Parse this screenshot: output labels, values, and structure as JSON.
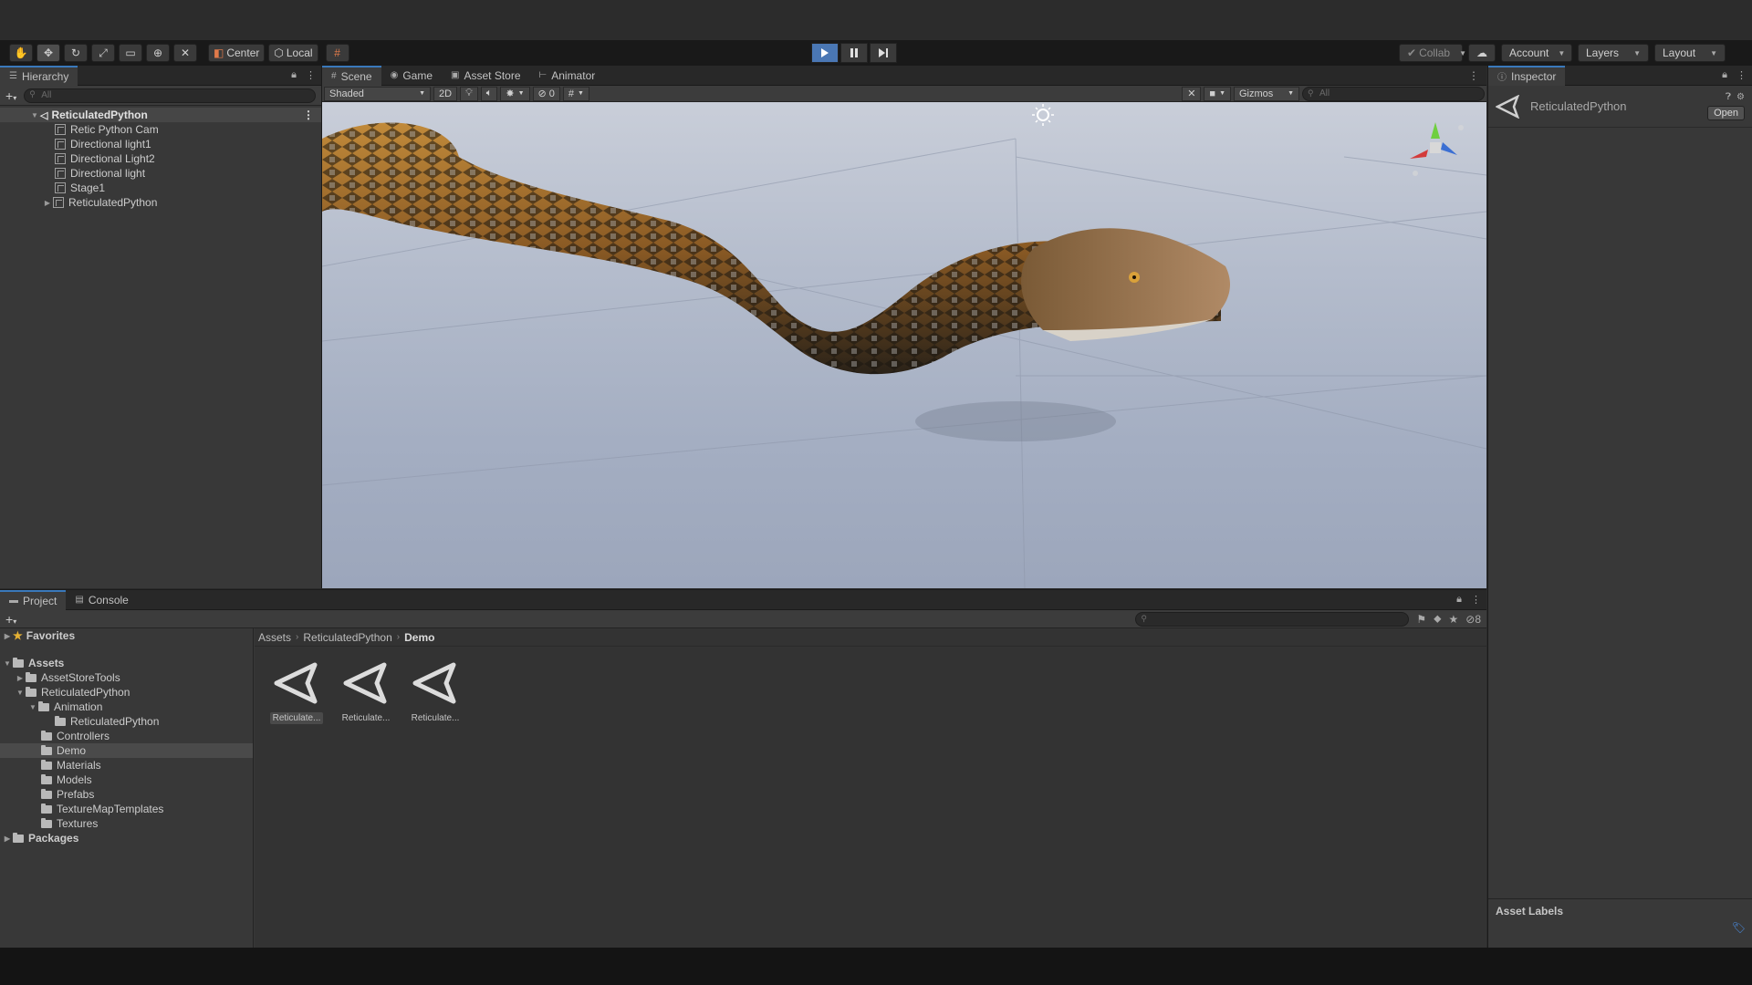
{
  "toolbar": {
    "pivot_center": "Center",
    "pivot_local": "Local",
    "collab": "Collab",
    "account": "Account",
    "layers": "Layers",
    "layout": "Layout"
  },
  "hierarchy": {
    "tab": "Hierarchy",
    "search_placeholder": "All",
    "root": "ReticulatedPython",
    "items": [
      "Retic Python Cam",
      "Directional light1",
      "Directional Light2",
      "Directional light",
      "Stage1",
      "ReticulatedPython"
    ]
  },
  "scene": {
    "tabs": [
      "Scene",
      "Game",
      "Asset Store",
      "Animator"
    ],
    "draw_mode": "Shaded",
    "mode_2d": "2D",
    "hidden_count": "0",
    "gizmos": "Gizmos",
    "search_placeholder": "All"
  },
  "inspector": {
    "tab": "Inspector",
    "object_name": "ReticulatedPython",
    "open_button": "Open",
    "asset_labels": "Asset Labels"
  },
  "project": {
    "tabs": [
      "Project",
      "Console"
    ],
    "favorites": "Favorites",
    "assets_root": "Assets",
    "tree": [
      "AssetStoreTools",
      "ReticulatedPython",
      "Animation",
      "ReticulatedPython",
      "Controllers",
      "Demo",
      "Materials",
      "Models",
      "Prefabs",
      "TextureMapTemplates",
      "Textures"
    ],
    "packages": "Packages",
    "breadcrumb": [
      "Assets",
      "ReticulatedPython",
      "Demo"
    ],
    "hidden_count": "8",
    "assets": [
      "Reticulate...",
      "Reticulate...",
      "Reticulate..."
    ]
  },
  "colors": {
    "accent": "#3a79bb",
    "play_active": "#4a77b4",
    "panel": "#383838",
    "toolbar": "#191919"
  }
}
